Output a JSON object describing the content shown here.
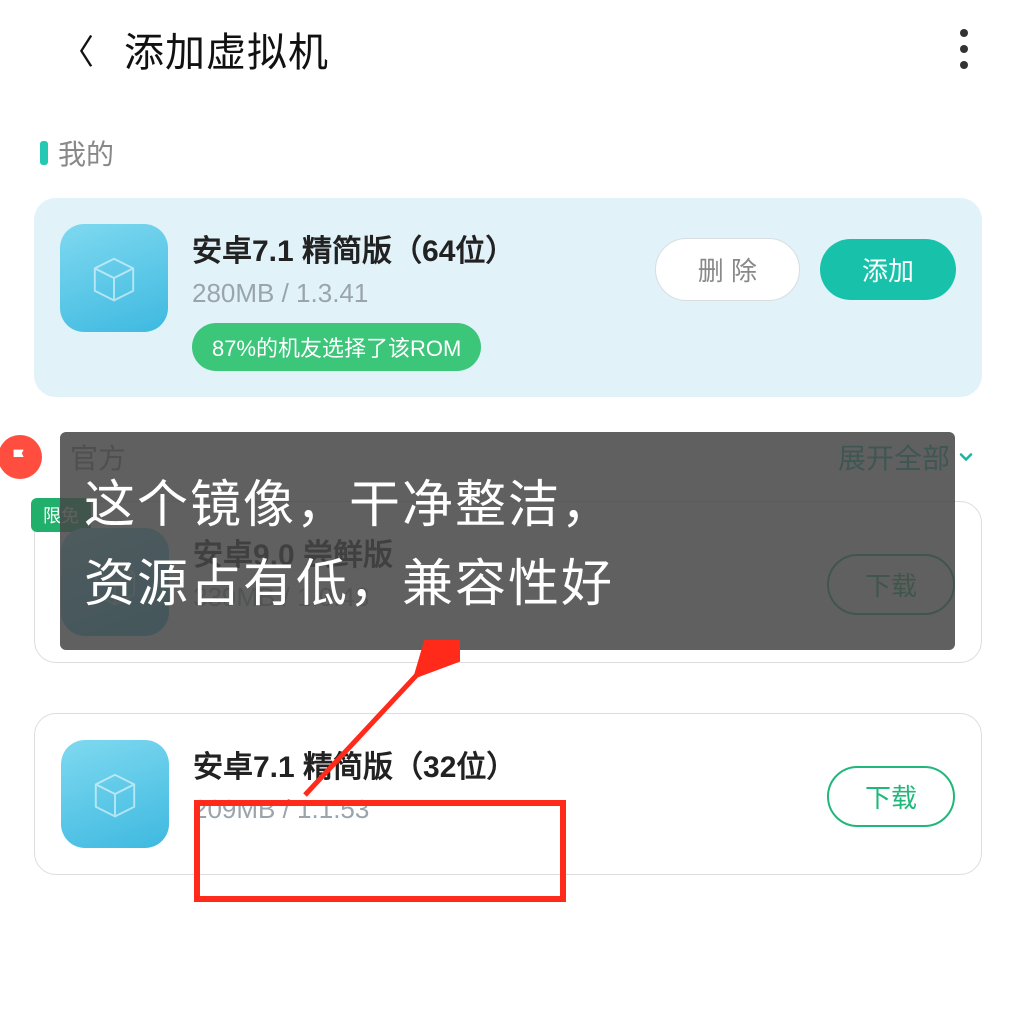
{
  "header": {
    "title": "添加虚拟机"
  },
  "sections": {
    "mine_label": "我的",
    "official_label": "官方",
    "expand_label": "展开全部"
  },
  "cards": {
    "mine": {
      "title": "安卓7.1 精简版（64位）",
      "meta": "280MB / 1.3.41",
      "pill": "87%的机友选择了该ROM",
      "delete_label": "删 除",
      "add_label": "添加"
    },
    "off1": {
      "title": "安卓9.0 尝鲜版",
      "meta": "339MB / 1.0.43",
      "ribbon": "限免",
      "download_label": "下载"
    },
    "off2": {
      "title": "安卓7.1 精简版（32位）",
      "meta": "209MB / 1.1.53",
      "download_label": "下载"
    }
  },
  "annotation": {
    "line1": "这个镜像，干净整洁，",
    "line2": "资源占有低，兼容性好"
  }
}
